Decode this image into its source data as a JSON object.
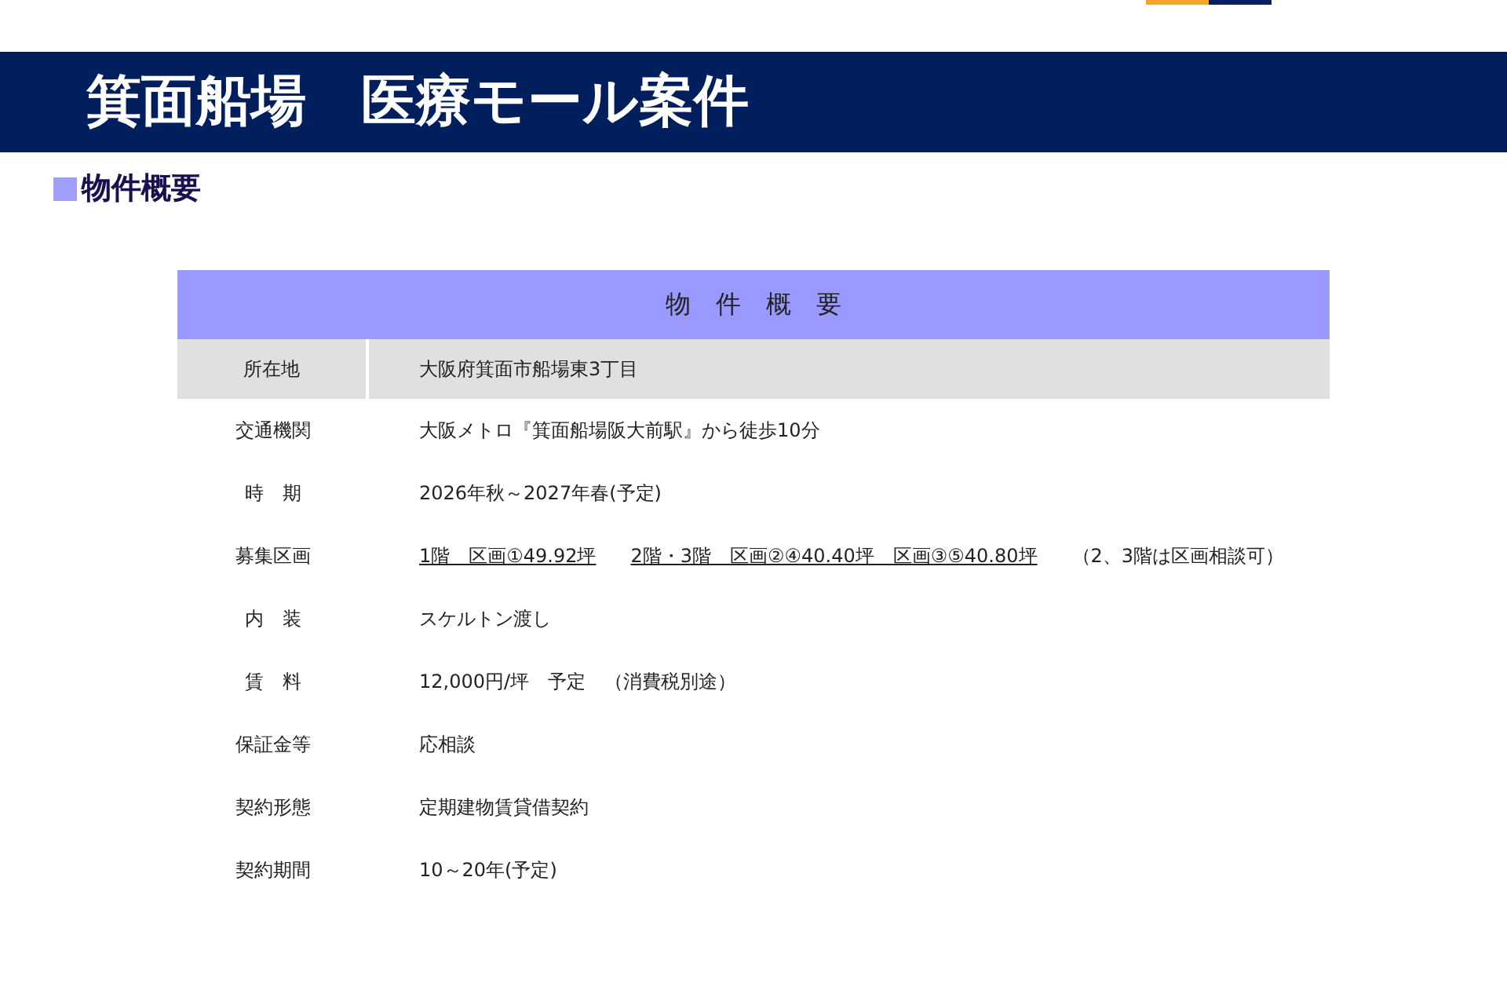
{
  "page_title": "箕面船場　医療モール案件",
  "section_heading": "物件概要",
  "table": {
    "title": "物　件　概　要",
    "rows": [
      {
        "label": "所在地",
        "shaded": true,
        "value": [
          {
            "text": "大阪府箕面市船場東3丁目",
            "underlined": false
          }
        ]
      },
      {
        "label": "交通機関",
        "shaded": false,
        "value": [
          {
            "text": "大阪メトロ『箕面船場阪大前駅』から徒歩10分",
            "underlined": false
          }
        ]
      },
      {
        "label": "時　期",
        "shaded": false,
        "value": [
          {
            "text": "2026年秋～2027年春(予定)",
            "underlined": false
          }
        ]
      },
      {
        "label": "募集区画",
        "shaded": false,
        "value": [
          {
            "text": "1階　区画①49.92坪",
            "underlined": true
          },
          {
            "text": "2階・3階　区画②④40.40坪　区画③⑤40.80坪",
            "underlined": true
          },
          {
            "text": "（2、3階は区画相談可）",
            "underlined": false
          }
        ]
      },
      {
        "label": "内　装",
        "shaded": false,
        "value": [
          {
            "text": "スケルトン渡し",
            "underlined": false
          }
        ]
      },
      {
        "label": "賃　料",
        "shaded": false,
        "value": [
          {
            "text": "12,000円/坪　予定　（消費税別途）",
            "underlined": false
          }
        ]
      },
      {
        "label": "保証金等",
        "shaded": false,
        "value": [
          {
            "text": "応相談",
            "underlined": false
          }
        ]
      },
      {
        "label": "契約形態",
        "shaded": false,
        "value": [
          {
            "text": "定期建物賃貸借契約",
            "underlined": false
          }
        ]
      },
      {
        "label": "契約期間",
        "shaded": false,
        "value": [
          {
            "text": "10～20年(予定)",
            "underlined": false
          }
        ]
      }
    ]
  }
}
